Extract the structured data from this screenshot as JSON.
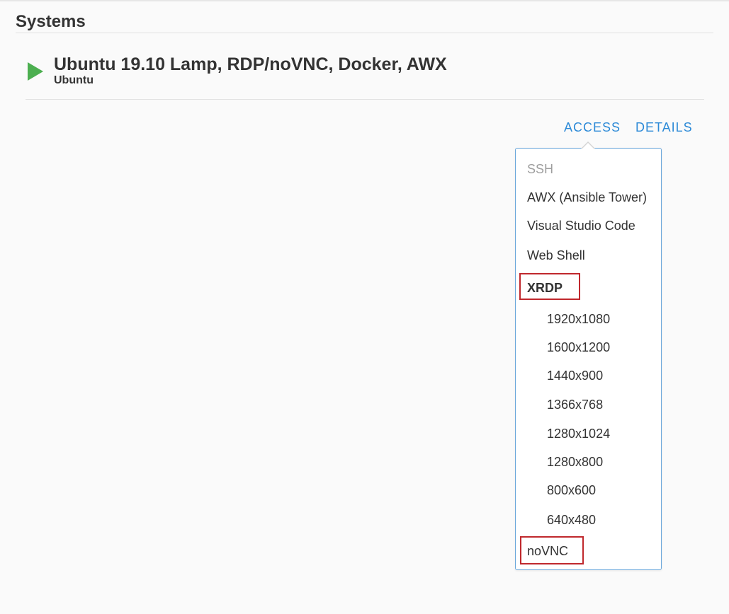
{
  "section": {
    "title": "Systems"
  },
  "system": {
    "name": "Ubuntu 19.10 Lamp, RDP/noVNC, Docker, AWX",
    "os": "Ubuntu",
    "status_icon": "play-icon",
    "status_color": "#4caf50"
  },
  "tabs": {
    "access": "ACCESS",
    "details": "DETAILS"
  },
  "access_menu": {
    "ssh": "SSH",
    "awx": "AWX (Ansible Tower)",
    "vscode": "Visual Studio Code",
    "webshell": "Web Shell",
    "xrdp": "XRDP",
    "xrdp_resolutions": [
      "1920x1080",
      "1600x1200",
      "1440x900",
      "1366x768",
      "1280x1024",
      "1280x800",
      "800x600",
      "640x480"
    ],
    "novnc": "noVNC"
  },
  "colors": {
    "link": "#2d8ad7",
    "highlight": "#c0282d",
    "dropdown_border": "#6aa7db"
  }
}
